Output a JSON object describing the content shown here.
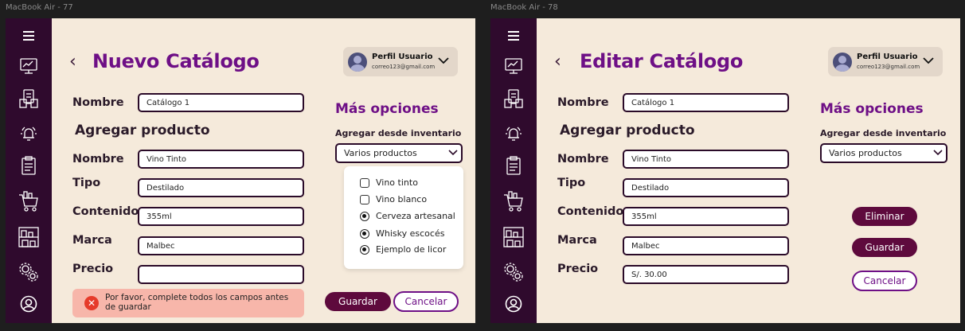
{
  "frames": {
    "f77": {
      "label": "MacBook Air - 77",
      "back": "‹",
      "title": "Nuevo Catálogo",
      "profile": {
        "name": "Perfil Usuario",
        "email": "correo123@gmail.com"
      },
      "catalog_name_label": "Nombre",
      "catalog_name_value": "Catálogo 1",
      "section_title": "Agregar producto",
      "fields": {
        "nombre": {
          "label": "Nombre",
          "value": "Vino Tinto"
        },
        "tipo": {
          "label": "Tipo",
          "value": "Destilado"
        },
        "contenido": {
          "label": "Contenido",
          "value": "355ml"
        },
        "marca": {
          "label": "Marca",
          "value": "Malbec"
        },
        "precio": {
          "label": "Precio",
          "value": ""
        }
      },
      "more_options_title": "Más opciones",
      "inventory_label": "Agregar desde inventario",
      "inventory_select": "Varios productos",
      "inventory_options": [
        {
          "label": "Vino tinto",
          "checked": false
        },
        {
          "label": "Vino blanco",
          "checked": false
        },
        {
          "label": "Cerveza artesanal",
          "checked": true
        },
        {
          "label": "Whisky escocés",
          "checked": true
        },
        {
          "label": "Ejemplo de licor",
          "checked": true
        }
      ],
      "error_message": "Por favor, complete todos los campos antes de guardar",
      "save_label": "Guardar",
      "cancel_label": "Cancelar"
    },
    "f78": {
      "label": "MacBook Air - 78",
      "back": "‹",
      "title": "Editar Catálogo",
      "profile": {
        "name": "Perfil Usuario",
        "email": "correo123@gmail.com"
      },
      "catalog_name_label": "Nombre",
      "catalog_name_value": "Catálogo 1",
      "section_title": "Agregar producto",
      "fields": {
        "nombre": {
          "label": "Nombre",
          "value": "Vino Tinto"
        },
        "tipo": {
          "label": "Tipo",
          "value": "Destilado"
        },
        "contenido": {
          "label": "Contenido",
          "value": "355ml"
        },
        "marca": {
          "label": "Marca",
          "value": "Malbec"
        },
        "precio": {
          "label": "Precio",
          "value": "S/. 30.00"
        }
      },
      "more_options_title": "Más opciones",
      "inventory_label": "Agregar desde inventario",
      "inventory_select": "Varios productos",
      "delete_label": "Eliminar",
      "save_label": "Guardar",
      "cancel_label": "Cancelar"
    }
  },
  "sidebar_icons": [
    "menu-icon",
    "dashboard-icon",
    "catalog-icon",
    "alarm-icon",
    "report-icon",
    "cart-icon",
    "warehouse-icon",
    "settings-icon",
    "user-icon"
  ],
  "colors": {
    "sidebar": "#2f0a2d",
    "background": "#f5eadb",
    "accent": "#6e0f86",
    "primary_button": "#5e0a3d",
    "error_bg": "#f7b6aa",
    "error_icon": "#e63a2a"
  }
}
